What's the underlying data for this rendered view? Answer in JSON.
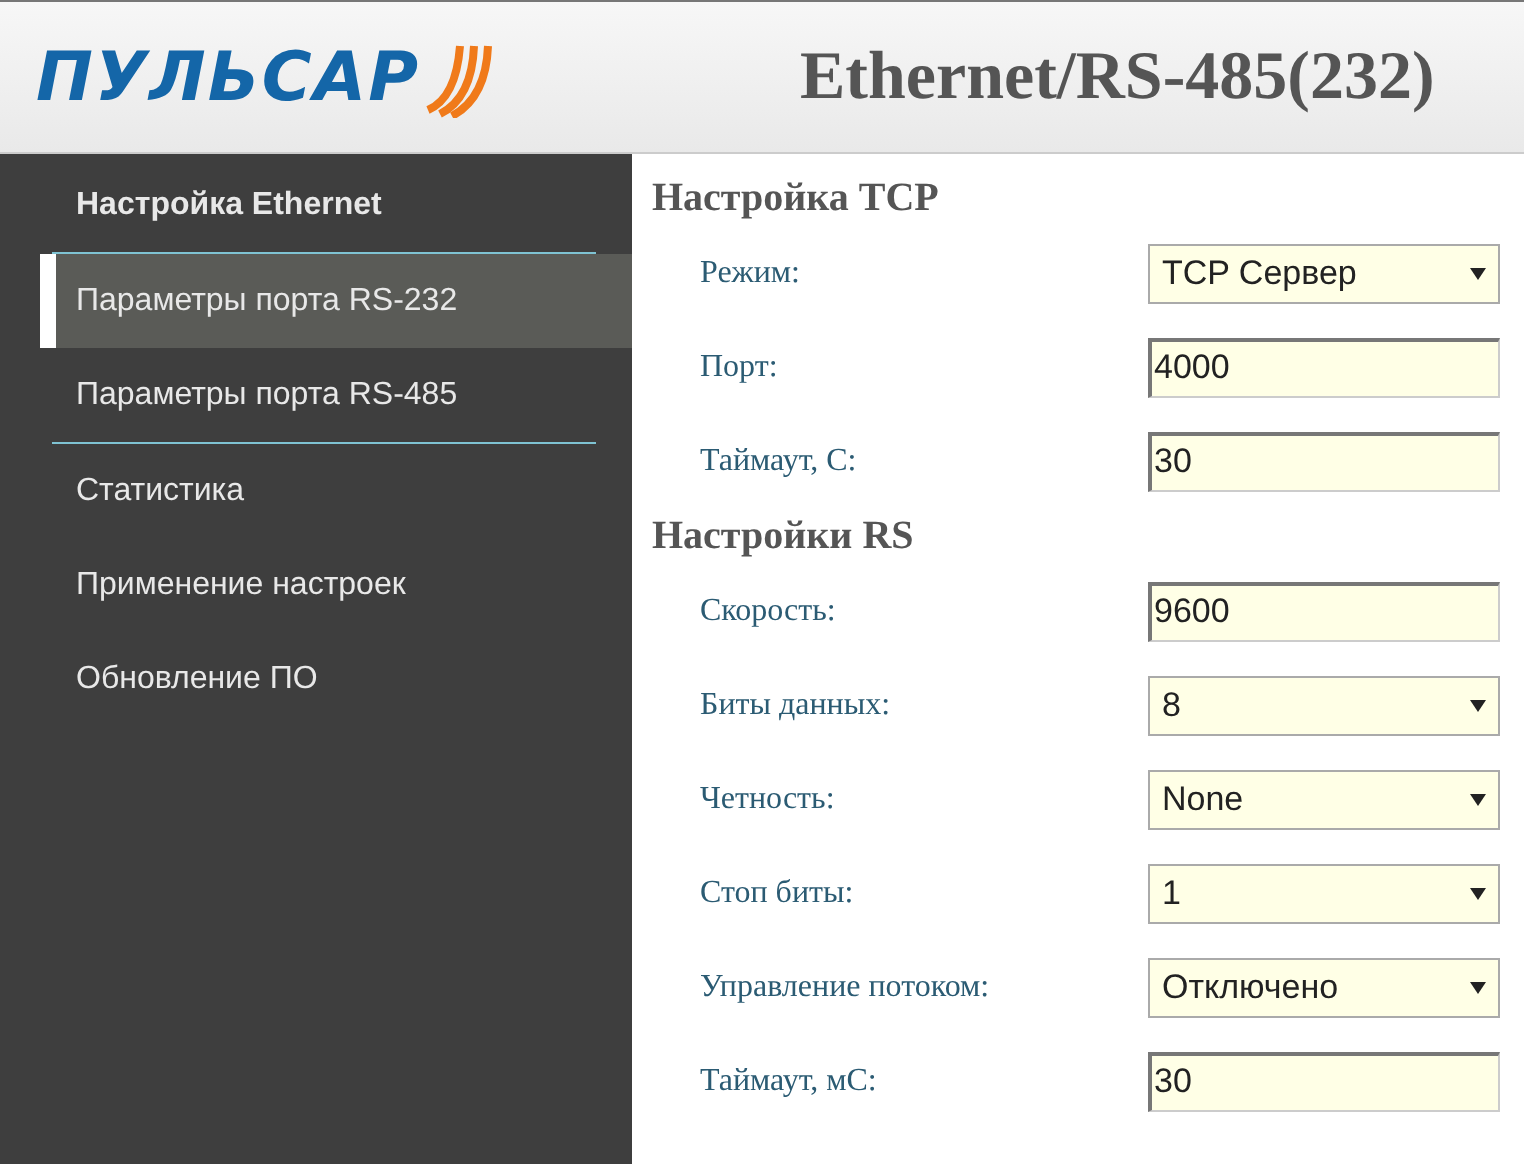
{
  "header": {
    "logo": "ПУЛЬСАР",
    "title": "Ethernet/RS-485(232)"
  },
  "sidebar": {
    "items": [
      {
        "kind": "heading",
        "label": "Настройка Ethernet",
        "selected": false
      },
      {
        "kind": "divider"
      },
      {
        "kind": "link",
        "label": "Параметры порта RS-232",
        "selected": true
      },
      {
        "kind": "link",
        "label": "Параметры порта RS-485",
        "selected": false
      },
      {
        "kind": "divider"
      },
      {
        "kind": "link",
        "label": "Статистика",
        "selected": false
      },
      {
        "kind": "link",
        "label": "Применение настроек",
        "selected": false
      },
      {
        "kind": "link",
        "label": "Обновление ПО",
        "selected": false
      }
    ]
  },
  "sections": [
    {
      "title": "Настройка TCP",
      "fields": [
        {
          "label": "Режим:",
          "kind": "select",
          "value": "TCP Сервер"
        },
        {
          "label": "Порт:",
          "kind": "input",
          "value": "4000"
        },
        {
          "label": "Таймаут, С:",
          "kind": "input",
          "value": "30"
        }
      ]
    },
    {
      "title": "Настройки RS",
      "fields": [
        {
          "label": "Скорость:",
          "kind": "input",
          "value": "9600"
        },
        {
          "label": "Биты данных:",
          "kind": "select",
          "value": "8"
        },
        {
          "label": "Четность:",
          "kind": "select",
          "value": "None"
        },
        {
          "label": "Стоп биты:",
          "kind": "select",
          "value": "1"
        },
        {
          "label": "Управление потоком:",
          "kind": "select",
          "value": "Отключено"
        },
        {
          "label": "Таймаут, мС:",
          "kind": "input",
          "value": "30"
        }
      ]
    }
  ]
}
